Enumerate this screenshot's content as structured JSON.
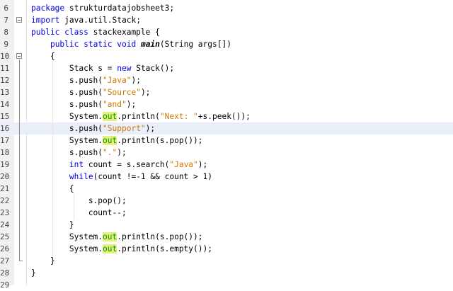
{
  "editor": {
    "lines": [
      {
        "n": "6",
        "tokens": [
          {
            "t": "package",
            "c": "kw"
          },
          {
            "t": " strukturdatajobsheet3;"
          }
        ]
      },
      {
        "n": "7",
        "tokens": [
          {
            "t": "import",
            "c": "kw"
          },
          {
            "t": " java.util.Stack;"
          }
        ]
      },
      {
        "n": "8",
        "tokens": [
          {
            "t": "public class",
            "c": "kw"
          },
          {
            "t": " stackexample {"
          }
        ]
      },
      {
        "n": "9",
        "tokens": [
          {
            "t": "    "
          },
          {
            "t": "public static void",
            "c": "kw"
          },
          {
            "t": " "
          },
          {
            "t": "main",
            "c": "bold"
          },
          {
            "t": "(String args[])"
          }
        ]
      },
      {
        "n": "10",
        "tokens": [
          {
            "t": "    {"
          }
        ]
      },
      {
        "n": "11",
        "tokens": [
          {
            "t": "        Stack s = "
          },
          {
            "t": "new",
            "c": "kw"
          },
          {
            "t": " Stack();"
          }
        ]
      },
      {
        "n": "12",
        "tokens": [
          {
            "t": "        s.push("
          },
          {
            "t": "\"Java\"",
            "c": "str"
          },
          {
            "t": ");"
          }
        ]
      },
      {
        "n": "13",
        "tokens": [
          {
            "t": "        s.push("
          },
          {
            "t": "\"Source\"",
            "c": "str"
          },
          {
            "t": ");"
          }
        ]
      },
      {
        "n": "14",
        "tokens": [
          {
            "t": "        s.push("
          },
          {
            "t": "\"and\"",
            "c": "str"
          },
          {
            "t": ");"
          }
        ]
      },
      {
        "n": "15",
        "tokens": [
          {
            "t": "        System."
          },
          {
            "t": "out",
            "c": "fld"
          },
          {
            "t": ".println("
          },
          {
            "t": "\"Next: \"",
            "c": "str"
          },
          {
            "t": "+s.peek());"
          }
        ]
      },
      {
        "n": "16",
        "tokens": [
          {
            "t": "        s.push("
          },
          {
            "t": "\"Support\"",
            "c": "str"
          },
          {
            "t": ");"
          }
        ],
        "highlight": true
      },
      {
        "n": "17",
        "tokens": [
          {
            "t": "        System."
          },
          {
            "t": "out",
            "c": "fld"
          },
          {
            "t": ".println(s.pop());"
          }
        ]
      },
      {
        "n": "18",
        "tokens": [
          {
            "t": "        s.push("
          },
          {
            "t": "\".\"",
            "c": "str"
          },
          {
            "t": ");"
          }
        ]
      },
      {
        "n": "19",
        "tokens": [
          {
            "t": "        "
          },
          {
            "t": "int",
            "c": "kw"
          },
          {
            "t": " count = s.search("
          },
          {
            "t": "\"Java\"",
            "c": "str"
          },
          {
            "t": ");"
          }
        ]
      },
      {
        "n": "20",
        "tokens": [
          {
            "t": "        "
          },
          {
            "t": "while",
            "c": "kw"
          },
          {
            "t": "(count !=-1 && count > 1)"
          }
        ]
      },
      {
        "n": "21",
        "tokens": [
          {
            "t": "        {"
          }
        ]
      },
      {
        "n": "22",
        "tokens": [
          {
            "t": "            s.pop();"
          }
        ]
      },
      {
        "n": "23",
        "tokens": [
          {
            "t": "            count--;"
          }
        ]
      },
      {
        "n": "24",
        "tokens": [
          {
            "t": "        }"
          }
        ]
      },
      {
        "n": "25",
        "tokens": [
          {
            "t": "        System."
          },
          {
            "t": "out",
            "c": "fld"
          },
          {
            "t": ".println(s.pop());"
          }
        ]
      },
      {
        "n": "26",
        "tokens": [
          {
            "t": "        System."
          },
          {
            "t": "out",
            "c": "fld"
          },
          {
            "t": ".println(s.empty());"
          }
        ]
      },
      {
        "n": "27",
        "tokens": [
          {
            "t": "    }"
          }
        ]
      },
      {
        "n": "28",
        "tokens": [
          {
            "t": "}"
          }
        ]
      },
      {
        "n": "29",
        "tokens": []
      }
    ]
  }
}
